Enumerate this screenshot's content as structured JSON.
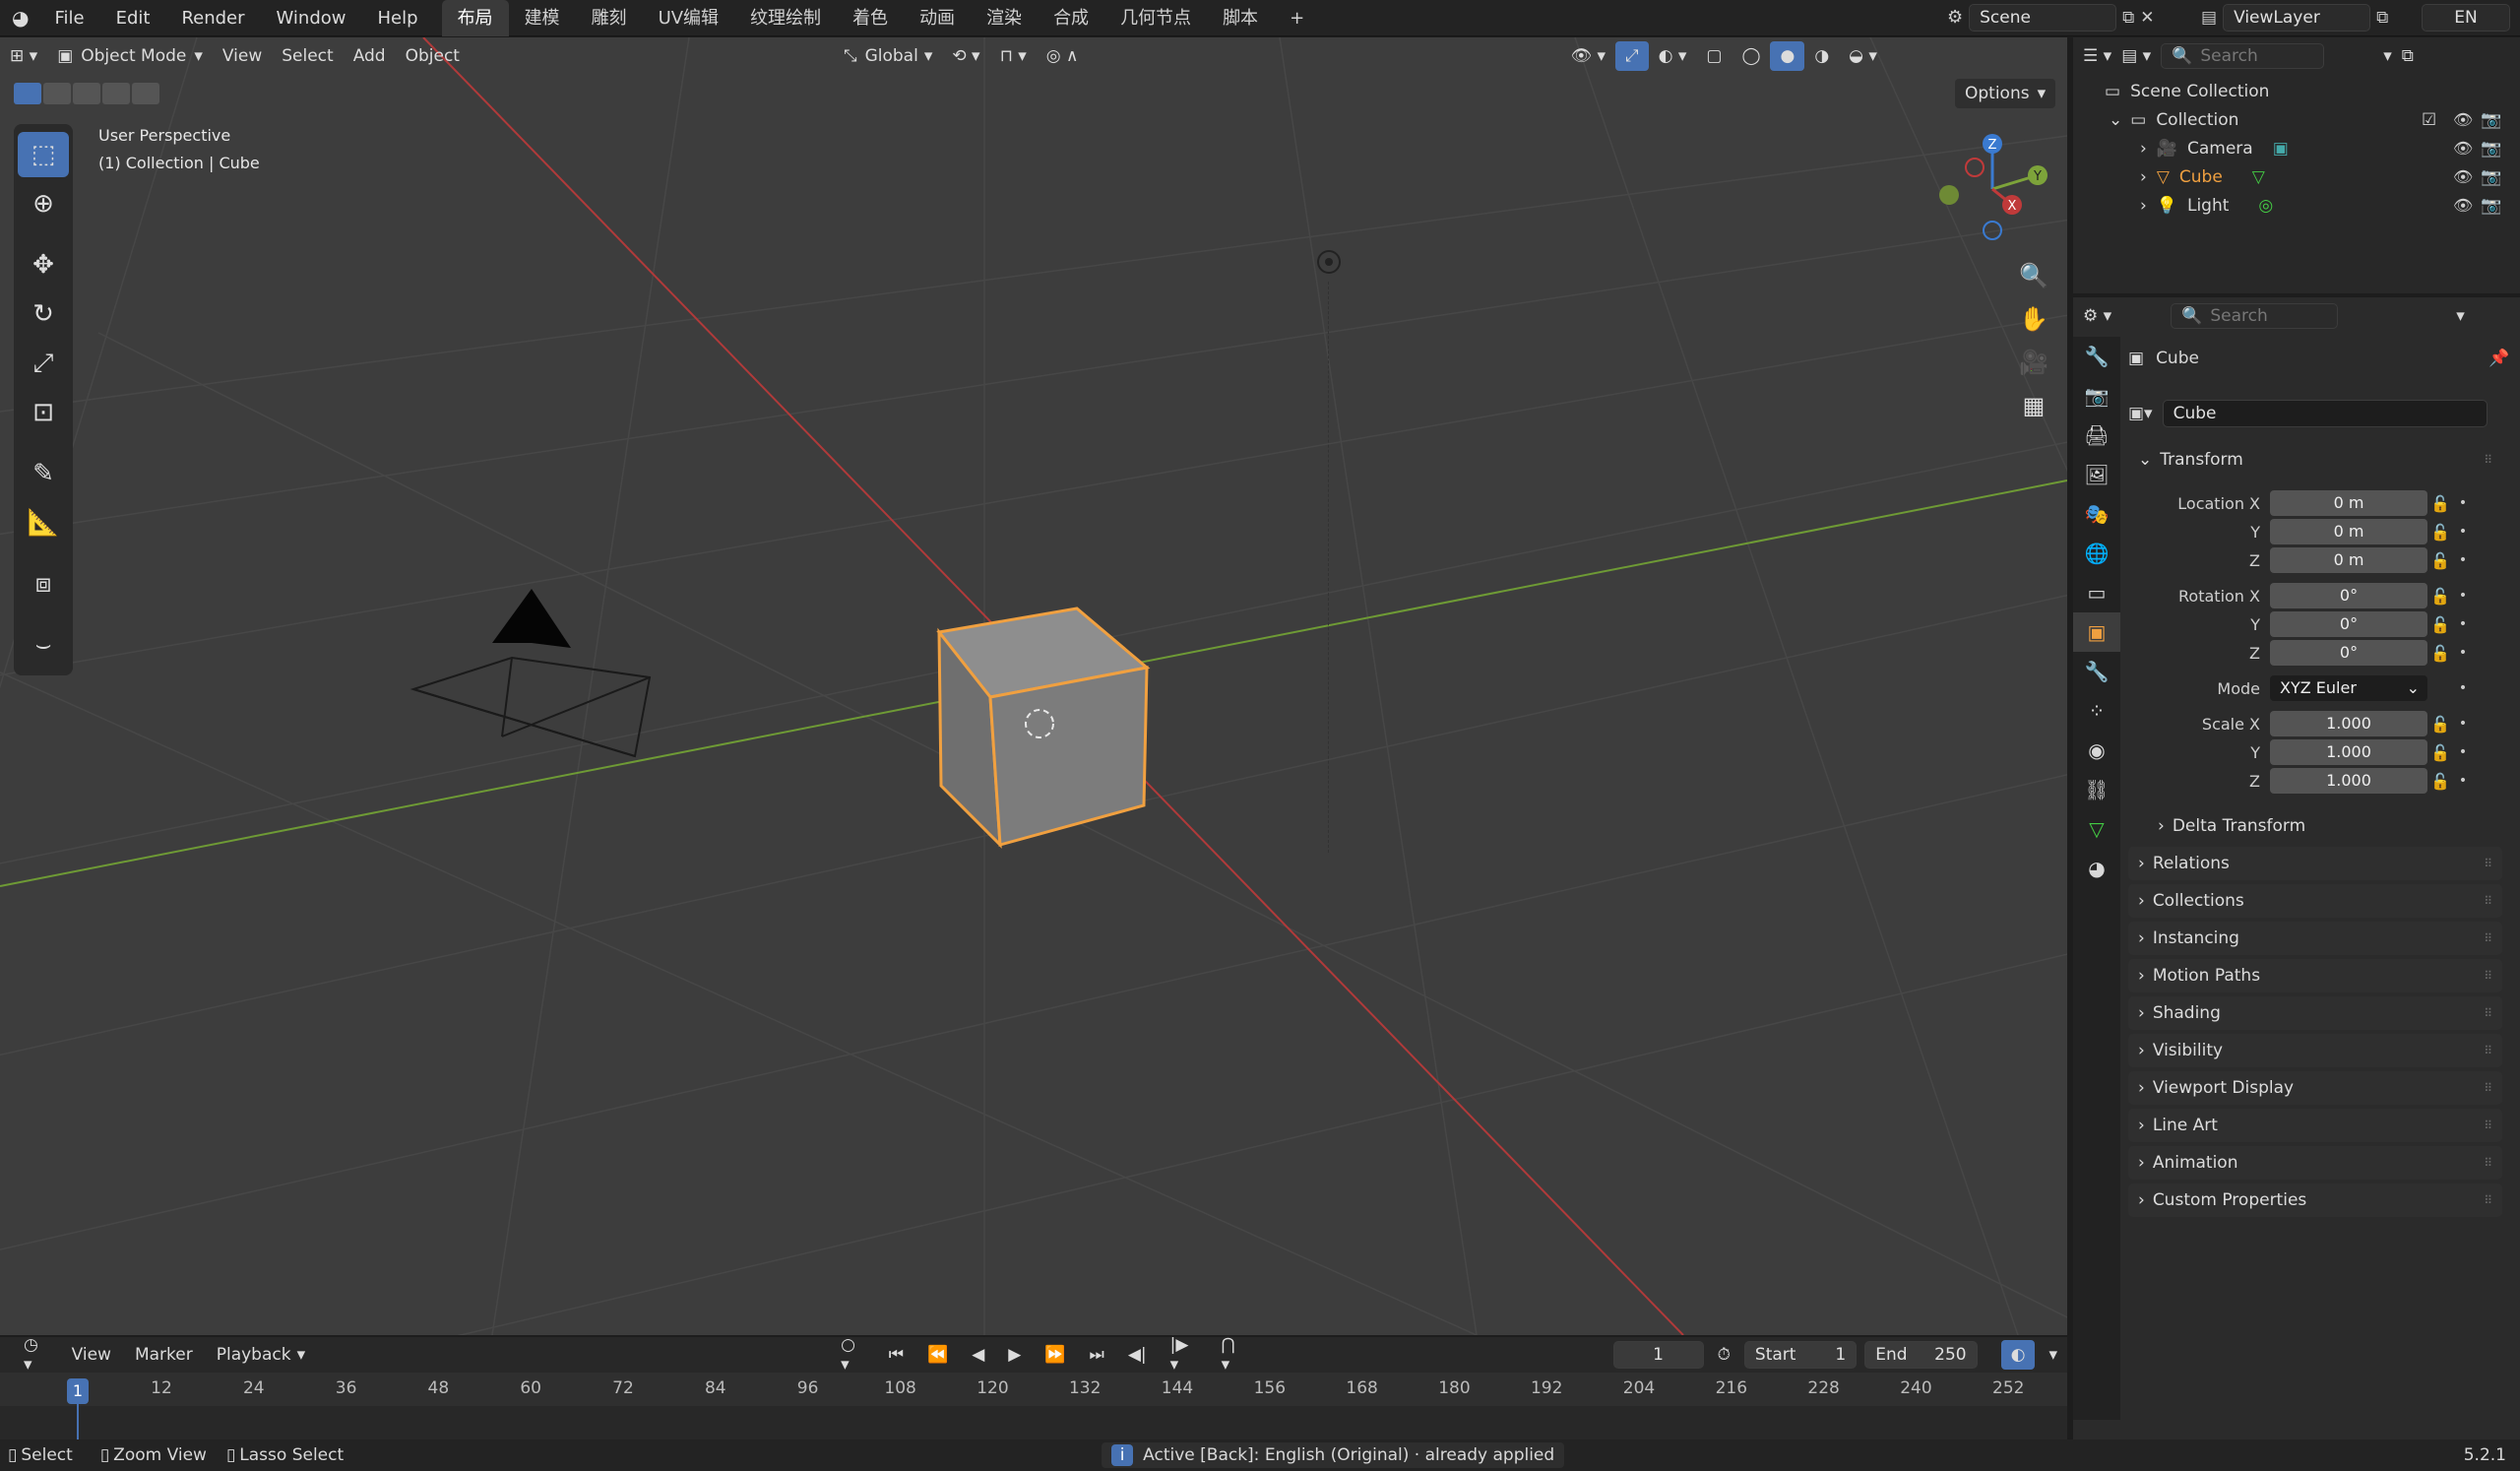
{
  "topbar": {
    "menus": [
      "File",
      "Edit",
      "Render",
      "Window",
      "Help"
    ],
    "workspaces": [
      "布局",
      "建模",
      "雕刻",
      "UV编辑",
      "纹理绘制",
      "着色",
      "动画",
      "渲染",
      "合成",
      "几何节点",
      "脚本"
    ],
    "add_tab": "+",
    "scene": "Scene",
    "view_layer": "ViewLayer",
    "lang": "EN"
  },
  "viewport": {
    "mode": "Object Mode",
    "menus": [
      "View",
      "Select",
      "Add",
      "Object"
    ],
    "transform_orientation": "Global",
    "options": "Options",
    "overlay_text": {
      "line1": "User Perspective",
      "line2": "(1) Collection | Cube"
    },
    "gizmo": {
      "z": "Z",
      "y": "Y",
      "x": "X"
    }
  },
  "outliner": {
    "search_placeholder": "Search",
    "scene_collection": "Scene Collection",
    "collection": "Collection",
    "items": [
      {
        "name": "Camera",
        "color": "#e0a050",
        "selected": false
      },
      {
        "name": "Cube",
        "color": "#f0a040",
        "selected": true
      },
      {
        "name": "Light",
        "color": "#e0a050",
        "selected": false
      }
    ]
  },
  "properties": {
    "search_placeholder": "Search",
    "object_name": "Cube",
    "data_name": "Cube",
    "transform_header": "Transform",
    "location": {
      "label": "Location X",
      "x": "0 m",
      "y": "0 m",
      "z": "0 m"
    },
    "rotation": {
      "label": "Rotation X",
      "x": "0°",
      "y": "0°",
      "z": "0°"
    },
    "mode_label": "Mode",
    "mode_value": "XYZ Euler",
    "scale": {
      "label": "Scale X",
      "x": "1.000",
      "y": "1.000",
      "z": "1.000"
    },
    "axis_y": "Y",
    "axis_z": "Z",
    "delta_transform": "Delta Transform",
    "panels": [
      "Relations",
      "Collections",
      "Instancing",
      "Motion Paths",
      "Shading",
      "Visibility",
      "Viewport Display",
      "Line Art",
      "Animation",
      "Custom Properties"
    ]
  },
  "timeline": {
    "menus": [
      "View",
      "Marker",
      "Playback"
    ],
    "current_frame": "1",
    "start_label": "Start",
    "start": "1",
    "end_label": "End",
    "end": "250",
    "ticks": [
      "1",
      "12",
      "24",
      "36",
      "48",
      "60",
      "72",
      "84",
      "96",
      "108",
      "120",
      "132",
      "144",
      "156",
      "168",
      "180",
      "192",
      "204",
      "216",
      "228",
      "240",
      "252"
    ]
  },
  "status": {
    "select": "Select",
    "zoom": "Zoom View",
    "lasso": "Lasso Select",
    "message": "Active [Back]: English (Original)  ·  already applied",
    "version": "5.2.1"
  },
  "colors": {
    "accent": "#4772b3",
    "selection": "#f0a040",
    "x_axis": "#c03a3a",
    "y_axis": "#7da33a",
    "z_axis": "#3a7ad0"
  }
}
